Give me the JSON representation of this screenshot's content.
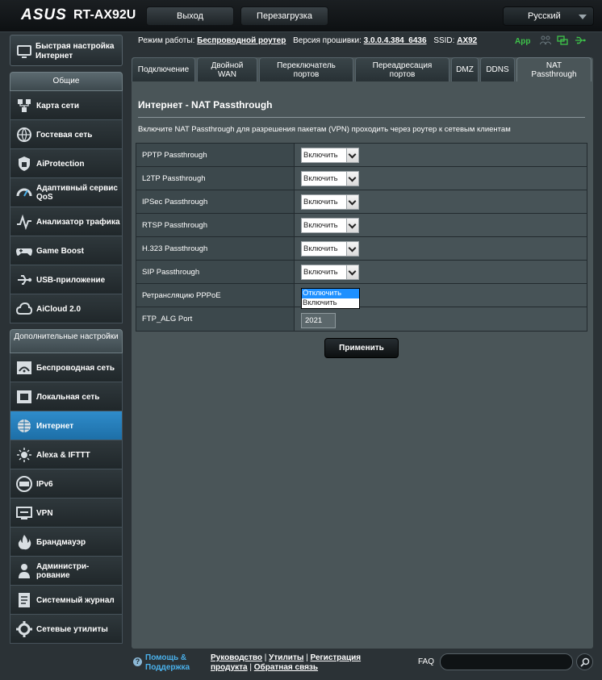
{
  "header": {
    "logo": "ASUS",
    "model": "RT-AX92U",
    "logout_label": "Выход",
    "reboot_label": "Перезагрузка",
    "language": "Русский"
  },
  "status": {
    "mode_label": "Режим работы:",
    "mode_value": "Беспроводной роутер",
    "fw_label": "Версия прошивки:",
    "fw_value": "3.0.0.4.384_6436",
    "ssid_label": "SSID:",
    "ssid_value": "AX92",
    "app_label": "App"
  },
  "sidebar": {
    "quick_setup": "Быстрая настройка Интернет",
    "general_header": "Общие",
    "general_items": [
      {
        "label": "Карта сети",
        "icon": "network-map-icon"
      },
      {
        "label": "Гостевая сеть",
        "icon": "guest-network-icon"
      },
      {
        "label": "AiProtection",
        "icon": "shield-icon"
      },
      {
        "label": "Адаптивный сервис QoS",
        "icon": "qos-gauge-icon"
      },
      {
        "label": "Анализатор трафика",
        "icon": "traffic-analyzer-icon"
      },
      {
        "label": "Game Boost",
        "icon": "gamepad-icon"
      },
      {
        "label": "USB-приложение",
        "icon": "usb-icon"
      },
      {
        "label": "AiCloud 2.0",
        "icon": "cloud-icon"
      }
    ],
    "advanced_header": "Дополнительные настройки",
    "advanced_items": [
      {
        "label": "Беспроводная сеть",
        "icon": "wireless-icon"
      },
      {
        "label": "Локальная сеть",
        "icon": "lan-icon"
      },
      {
        "label": "Интернет",
        "icon": "globe-icon"
      },
      {
        "label": "Alexa & IFTTT",
        "icon": "alexa-icon"
      },
      {
        "label": "IPv6",
        "icon": "ipv6-icon"
      },
      {
        "label": "VPN",
        "icon": "vpn-icon"
      },
      {
        "label": "Брандмауэр",
        "icon": "firewall-icon"
      },
      {
        "label": "Администри-рование",
        "icon": "admin-icon"
      },
      {
        "label": "Системный журнал",
        "icon": "log-icon"
      },
      {
        "label": "Сетевые утилиты",
        "icon": "network-tools-icon"
      }
    ],
    "active_item": "Интернет"
  },
  "tabs": [
    {
      "label": "Подключение"
    },
    {
      "label": "Двойной WAN"
    },
    {
      "label": "Переключатель портов"
    },
    {
      "label": "Переадресация портов"
    },
    {
      "label": "DMZ"
    },
    {
      "label": "DDNS"
    },
    {
      "label": "NAT Passthrough"
    }
  ],
  "panel": {
    "title": "Интернет - NAT Passthrough",
    "description": "Включите NAT Passthrough для разрешения пакетам (VPN) проходить через роутер к сетевым клиентам",
    "rows": [
      {
        "label": "PPTP Passthrough",
        "value": "Включить"
      },
      {
        "label": "L2TP Passthrough",
        "value": "Включить"
      },
      {
        "label": "IPSec Passthrough",
        "value": "Включить"
      },
      {
        "label": "RTSP Passthrough",
        "value": "Включить"
      },
      {
        "label": "H.323 Passthrough",
        "value": "Включить"
      },
      {
        "label": "SIP Passthrough",
        "value": "Включить"
      }
    ],
    "pppoe_label": "Ретрансляцию PPPoE",
    "pppoe_options": [
      "Отключить",
      "Включить"
    ],
    "pppoe_highlighted": "Отключить",
    "ftp_label": "FTP_ALG Port",
    "ftp_value": "2021",
    "apply_label": "Применить"
  },
  "footer": {
    "help": "Помощь & Поддержка",
    "links": [
      "Руководство",
      "Утилиты",
      "Регистрация продукта",
      "Обратная связь"
    ],
    "faq": "FAQ"
  },
  "colors": {
    "accent_blue": "#1d6fa7",
    "app_green": "#3ec34a",
    "help_blue": "#4ab0ea"
  }
}
